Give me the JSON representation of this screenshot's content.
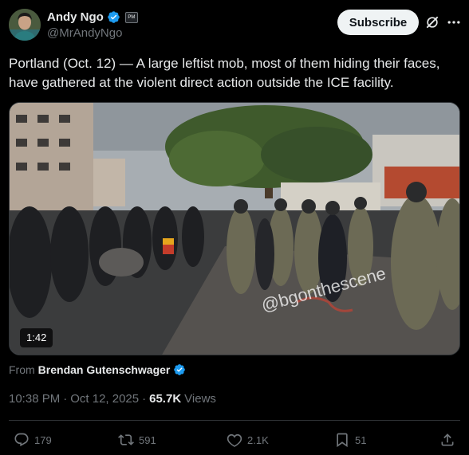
{
  "author": {
    "name": "Andy Ngo",
    "handle": "@MrAndyNgo",
    "affiliate_badge": "PM"
  },
  "header": {
    "subscribe_label": "Subscribe"
  },
  "tweet": {
    "text": "Portland (Oct. 12) — A large leftist mob, most of them hiding their faces, have gathered at the violent direct action outside the ICE facility."
  },
  "media": {
    "duration": "1:42",
    "watermark": "@bgonthescene"
  },
  "source": {
    "label": "From",
    "name": "Brendan Gutenschwager"
  },
  "meta": {
    "time": "10:38 PM",
    "separator": "·",
    "date": "Oct 12, 2025",
    "views_count": "65.7K",
    "views_label": "Views"
  },
  "actions": {
    "replies": "179",
    "reposts": "591",
    "likes": "2.1K",
    "bookmarks": "51"
  },
  "colors": {
    "background": "#000000",
    "text": "#e7e9ea",
    "muted": "#71767b",
    "verified_blue": "#1d9bf0",
    "divider": "#2f3336"
  }
}
